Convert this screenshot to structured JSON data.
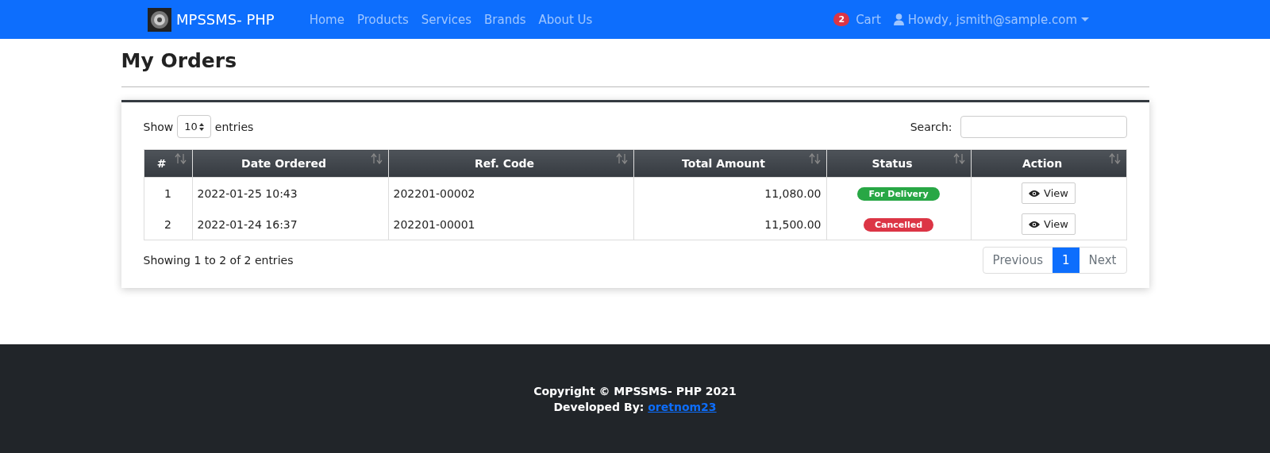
{
  "navbar": {
    "brand": "MPSSMS- PHP",
    "links": [
      {
        "label": "Home"
      },
      {
        "label": "Products"
      },
      {
        "label": "Services"
      },
      {
        "label": "Brands"
      },
      {
        "label": "About Us"
      }
    ],
    "cart_count": "2",
    "cart_label": "Cart",
    "user_label": "Howdy, jsmith@sample.com"
  },
  "page_title": "My Orders",
  "table_controls": {
    "show_label": "Show",
    "page_size": "10",
    "entries_label": "entries",
    "search_label": "Search:"
  },
  "table": {
    "columns": [
      {
        "label": "#"
      },
      {
        "label": "Date Ordered"
      },
      {
        "label": "Ref. Code"
      },
      {
        "label": "Total Amount"
      },
      {
        "label": "Status"
      },
      {
        "label": "Action"
      }
    ],
    "rows": [
      {
        "number": "1",
        "date": "2022-01-25 10:43",
        "ref": "202201-00002",
        "total": "11,080.00",
        "status": {
          "label": "For Delivery",
          "color": "#28a745"
        },
        "action": "View"
      },
      {
        "number": "2",
        "date": "2022-01-24 16:37",
        "ref": "202201-00001",
        "total": "11,500.00",
        "status": {
          "label": "Cancelled",
          "color": "#dc3545"
        },
        "action": "View"
      }
    ]
  },
  "info": "Showing 1 to 2 of 2 entries",
  "pagination": {
    "previous": "Previous",
    "pages": [
      {
        "label": "1",
        "selected": true
      }
    ],
    "next": "Next"
  },
  "footer": {
    "copyright": "Copyright © MPSSMS- PHP 2021",
    "developed_label": "Developed By:",
    "developer_link": "oretnom23"
  }
}
